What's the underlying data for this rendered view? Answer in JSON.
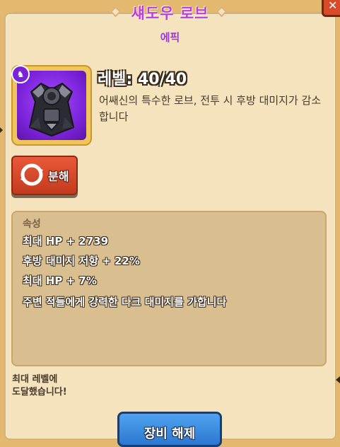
{
  "header": {
    "title": "섀도우 로브",
    "rarity": "에픽",
    "close_icon": "close-icon"
  },
  "item": {
    "icon": "shadow-robe-icon",
    "badge_icon": "class-badge-icon",
    "level_text": "레벨: 40/40",
    "description": "어쌔신의 특수한 로브, 전투 시 후방 대미지가 감소합니다"
  },
  "actions": {
    "dismantle_label": "분해",
    "dismantle_icon": "recycle-icon",
    "unequip_label": "장비 해제"
  },
  "stats": {
    "header": "속성",
    "lines": [
      "최대 HP + 2739",
      "후방 대미지 저항 + 22%",
      "최대 HP + 7%",
      "주변 적들에게 강력한 다크 대미지를 가합니다"
    ]
  },
  "footer": {
    "max_level_line1": "최대 레벨에",
    "max_level_line2": "도달했습니다!"
  },
  "colors": {
    "rarity_epic": "#9a3ad8",
    "title": "#b83ee0",
    "item_bg": "#7a22d8",
    "dismantle": "#d94a2a",
    "unequip": "#2c78d0"
  }
}
